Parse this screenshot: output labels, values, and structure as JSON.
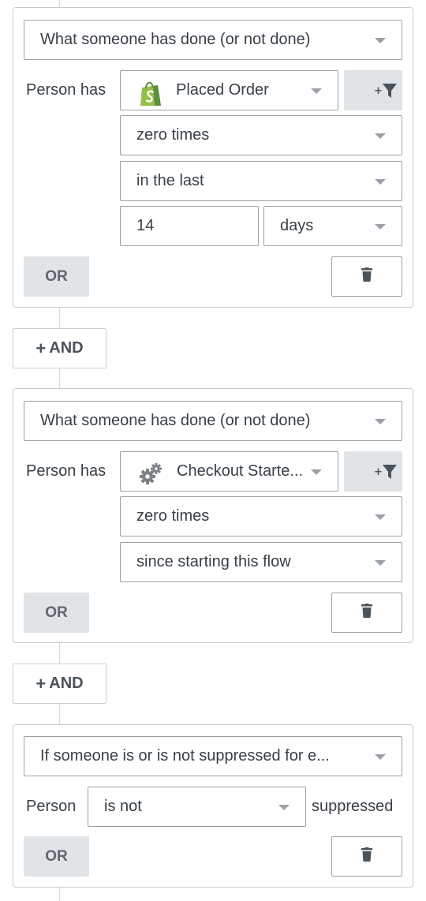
{
  "blocks": [
    {
      "condition_type": "What someone has done (or not done)",
      "person_has_label": "Person has",
      "metric": "Placed Order",
      "metric_icon": "shopify-icon",
      "frequency": "zero times",
      "timeframe": "in the last",
      "amount": "14",
      "unit": "days",
      "or_label": "OR",
      "filter_icon": "add-filter-icon",
      "delete_icon": "trash-icon"
    },
    {
      "condition_type": "What someone has done (or not done)",
      "person_has_label": "Person has",
      "metric": "Checkout Starte...",
      "metric_icon": "gears-icon",
      "frequency": "zero times",
      "timeframe": "since starting this flow",
      "or_label": "OR",
      "filter_icon": "add-filter-icon",
      "delete_icon": "trash-icon"
    },
    {
      "condition_type": "If someone is or is not suppressed for e...",
      "person_label": "Person",
      "status": "is not",
      "suffix": "suppressed",
      "or_label": "OR",
      "delete_icon": "trash-icon"
    }
  ],
  "and_buttons": [
    {
      "label": "AND"
    },
    {
      "label": "AND"
    }
  ],
  "colors": {
    "border": "#9aa1a8",
    "card_border": "#c9ced3",
    "button_gray": "#e1e4e7",
    "text": "#373f47",
    "shopify_green": "#95bf47"
  }
}
